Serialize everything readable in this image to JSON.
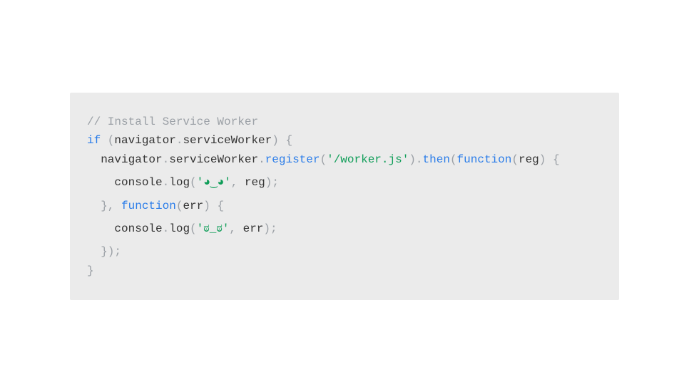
{
  "code": {
    "line1_comment": "// Install Service Worker",
    "line2_if": "if",
    "line2_open": " (",
    "line2_nav": "navigator",
    "line2_dot": ".",
    "line2_sw": "serviceWorker",
    "line2_close": ") {",
    "line3_indent": "  ",
    "line3_nav": "navigator",
    "line3_dot1": ".",
    "line3_sw": "serviceWorker",
    "line3_dot2": ".",
    "line3_register": "register",
    "line3_open": "(",
    "line3_str": "'/worker.js'",
    "line3_close": ")",
    "line3_dot3": ".",
    "line3_then": "then",
    "line3_open2": "(",
    "line3_func": "function",
    "line3_open3": "(",
    "line3_reg": "reg",
    "line3_close3": ") {",
    "line4_indent": "    ",
    "line4_console": "console",
    "line4_dot": ".",
    "line4_log": "log",
    "line4_open": "(",
    "line4_str": "'◕‿◕'",
    "line4_comma": ", ",
    "line4_reg": "reg",
    "line4_close": ");",
    "line5_indent": "  ",
    "line5_brace": "}, ",
    "line5_func": "function",
    "line5_open": "(",
    "line5_err": "err",
    "line5_close": ") {",
    "line6_indent": "    ",
    "line6_console": "console",
    "line6_dot": ".",
    "line6_log": "log",
    "line6_open": "(",
    "line6_str": "'ಠ_ಠ'",
    "line6_comma": ", ",
    "line6_err": "err",
    "line6_close": ");",
    "line7_indent": "  ",
    "line7_close": "});",
    "line8_close": "}"
  }
}
